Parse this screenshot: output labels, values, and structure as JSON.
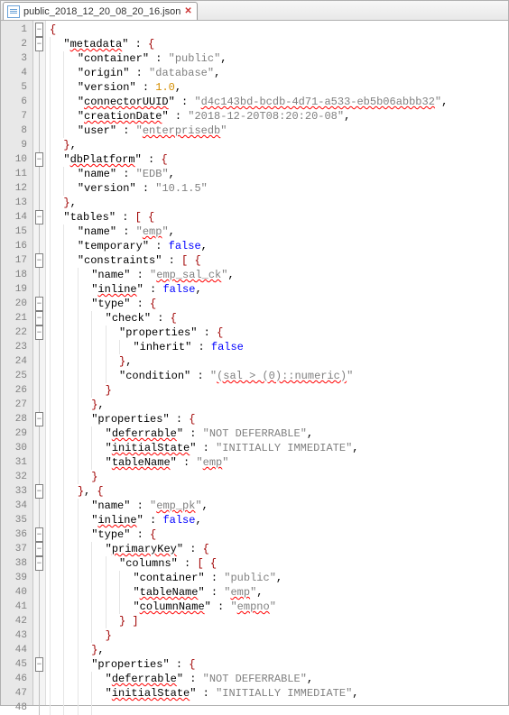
{
  "tab": {
    "filename": "public_2018_12_20_08_20_16.json"
  },
  "tokens": {
    "open_brace": "{",
    "close_brace": "}",
    "open_bracket": "[",
    "close_bracket": "]",
    "colon": " : ",
    "comma": ",",
    "minus": "−"
  },
  "code": {
    "metadata_key": "metadata",
    "metadata_container_k": "container",
    "metadata_container_v": "public",
    "metadata_origin_k": "origin",
    "metadata_origin_v": "database",
    "metadata_version_k": "version",
    "metadata_version_v": "1.0",
    "metadata_uuid_k": "connectorUUID",
    "metadata_uuid_v": "d4c143bd-bcdb-4d71-a533-eb5b06abbb32",
    "metadata_cdate_k": "creationDate",
    "metadata_cdate_v": "2018-12-20T08:20:20-08",
    "metadata_user_k": "user",
    "metadata_user_v": "enterprisedb",
    "dbplat_key": "dbPlatform",
    "dbplat_name_k": "name",
    "dbplat_name_v": "EDB",
    "dbplat_ver_k": "version",
    "dbplat_ver_v": "10.1.5",
    "tables_key": "tables",
    "t_name_k": "name",
    "t_name_v": "emp",
    "t_temporary_k": "temporary",
    "t_temporary_v": "false",
    "t_constraints_k": "constraints",
    "c1_name_v": "emp_sal_ck",
    "inline_k": "inline",
    "inline_v": "false",
    "type_k": "type",
    "check_k": "check",
    "properties_k": "properties",
    "inherit_k": "inherit",
    "inherit_v": "false",
    "condition_k": "condition",
    "condition_v": "(sal > (0)::numeric)",
    "deferrable_k": "deferrable",
    "deferrable_v": "NOT DEFERRABLE",
    "initstate_k": "initialState",
    "initstate_v": "INITIALLY IMMEDIATE",
    "tableName_k": "tableName",
    "tableName_v": "emp",
    "c2_name_v": "emp_pk",
    "primaryKey_k": "primaryKey",
    "columns_k": "columns",
    "col_container_v": "public",
    "col_tableName_v": "emp",
    "columnName_k": "columnName",
    "columnName_v": "empno"
  },
  "line_count": 48
}
